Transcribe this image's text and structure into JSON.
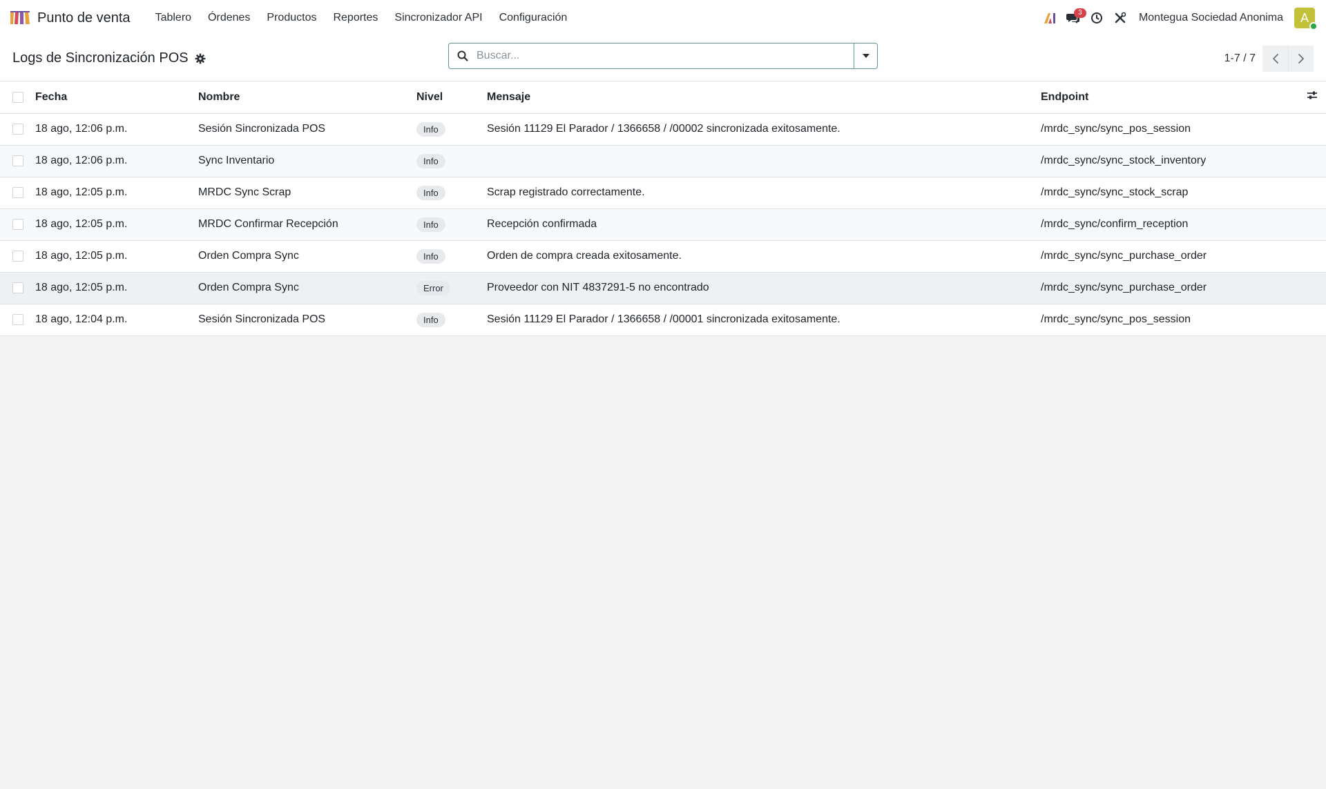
{
  "navbar": {
    "app_name": "Punto de venta",
    "menu": [
      "Tablero",
      "Órdenes",
      "Productos",
      "Reportes",
      "Sincronizador API",
      "Configuración"
    ],
    "messages_count": "3",
    "company": "Montegua Sociedad Anonima",
    "avatar_initial": "A"
  },
  "control_panel": {
    "title": "Logs de Sincronización POS",
    "search_placeholder": "Buscar...",
    "pager": "1-7 / 7"
  },
  "table": {
    "columns": [
      "Fecha",
      "Nombre",
      "Nivel",
      "Mensaje",
      "Endpoint"
    ],
    "rows": [
      {
        "fecha": "18 ago, 12:06 p.m.",
        "nombre": "Sesión Sincronizada POS",
        "nivel": "Info",
        "mensaje": "Sesión 11129 El Parador / 1366658 / /00002 sincronizada exitosamente.",
        "endpoint": "/mrdc_sync/sync_pos_session"
      },
      {
        "fecha": "18 ago, 12:06 p.m.",
        "nombre": "Sync Inventario",
        "nivel": "Info",
        "mensaje": "",
        "endpoint": "/mrdc_sync/sync_stock_inventory"
      },
      {
        "fecha": "18 ago, 12:05 p.m.",
        "nombre": "MRDC Sync Scrap",
        "nivel": "Info",
        "mensaje": "Scrap registrado correctamente.",
        "endpoint": "/mrdc_sync/sync_stock_scrap"
      },
      {
        "fecha": "18 ago, 12:05 p.m.",
        "nombre": "MRDC Confirmar Recepción",
        "nivel": "Info",
        "mensaje": "Recepción confirmada",
        "endpoint": "/mrdc_sync/confirm_reception"
      },
      {
        "fecha": "18 ago, 12:05 p.m.",
        "nombre": "Orden Compra Sync",
        "nivel": "Info",
        "mensaje": "Orden de compra creada exitosamente.",
        "endpoint": "/mrdc_sync/sync_purchase_order"
      },
      {
        "fecha": "18 ago, 12:05 p.m.",
        "nombre": "Orden Compra Sync",
        "nivel": "Error",
        "mensaje": "Proveedor con NIT 4837291-5 no encontrado",
        "endpoint": "/mrdc_sync/sync_purchase_order"
      },
      {
        "fecha": "18 ago, 12:04 p.m.",
        "nombre": "Sesión Sincronizada POS",
        "nivel": "Info",
        "mensaje": "Sesión 11129 El Parador / 1366658 / /00001 sincronizada exitosamente.",
        "endpoint": "/mrdc_sync/sync_pos_session"
      }
    ]
  },
  "icons": {
    "brand": "pos-awning-icon",
    "ai": "ai-assistant-icon",
    "messages": "chat-bubbles-icon",
    "activity": "clock-icon",
    "debug": "tools-icon",
    "title_gear": "gear-icon",
    "search": "search-icon",
    "search_toggle": "caret-down-icon",
    "prev": "chevron-left-icon",
    "next": "chevron-right-icon",
    "optional_columns": "sliders-icon"
  },
  "colors": {
    "search_border": "#5f95a0",
    "badge": "#d9414a",
    "avatar": "#c3c13a",
    "online": "#28a745"
  }
}
